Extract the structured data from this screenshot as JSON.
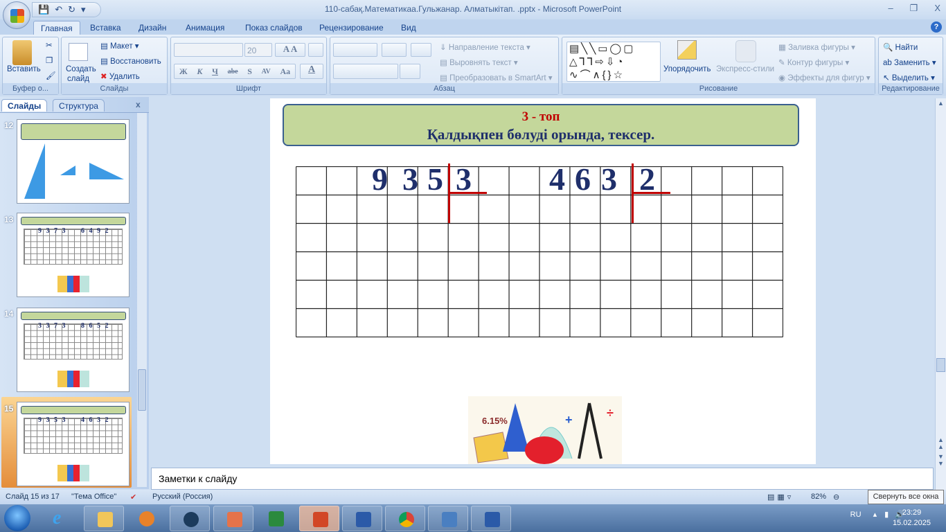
{
  "window": {
    "title": "110-сабақ.Математикаа.Гульжанар. Алматыкітап.     .pptx - Microsoft PowerPoint"
  },
  "ribbon_tabs": [
    "Главная",
    "Вставка",
    "Дизайн",
    "Анимация",
    "Показ слайдов",
    "Рецензирование",
    "Вид"
  ],
  "clipboard": {
    "paste": "Вставить",
    "group": "Буфер о..."
  },
  "slides_group": {
    "new_slide_1": "Создать",
    "new_slide_2": "слайд",
    "layout": "Макет",
    "reset": "Восстановить",
    "delete": "Удалить",
    "group": "Слайды"
  },
  "font": {
    "name": "",
    "size": "20",
    "group": "Шрифт",
    "bold": "Ж",
    "italic": "К",
    "underline": "Ч",
    "strike": "abe",
    "shadow": "S",
    "spacing": "AV",
    "case": "Aa",
    "color": "A"
  },
  "paragraph": {
    "text_direction": "Направление текста",
    "align_text": "Выровнять текст",
    "smartart": "Преобразовать в SmartArt",
    "group": "Абзац"
  },
  "drawing": {
    "arrange": "Упорядочить",
    "quick_styles": "Экспресс-стили",
    "fill": "Заливка фигуры",
    "outline": "Контур фигуры",
    "effects": "Эффекты для фигур",
    "group": "Рисование"
  },
  "editing": {
    "find": "Найти",
    "replace": "Заменить",
    "select": "Выделить",
    "group": "Редактирование"
  },
  "panel": {
    "tab_slides": "Слайды",
    "tab_outline": "Структура",
    "close": "x"
  },
  "thumbnails": [
    {
      "num": "12"
    },
    {
      "num": "13",
      "left": "9 3 7 3",
      "right": "6 4 9 2"
    },
    {
      "num": "14",
      "left": "3 3 7 3",
      "right": "8 6 5 2"
    },
    {
      "num": "15",
      "left": "9 3 5 3",
      "right": "4 6 3 2"
    }
  ],
  "slide": {
    "group_title": "3 - топ",
    "task": "Қалдықпен бөлуді орында, тексер.",
    "left": {
      "digits": [
        "9",
        "3",
        "5"
      ],
      "divisor": "3"
    },
    "right": {
      "digits": [
        "4",
        "6",
        "3"
      ],
      "divisor": "2"
    },
    "clipart_label": "6.15%"
  },
  "notes_placeholder": "Заметки к слайду",
  "status": {
    "slide": "Слайд 15 из 17",
    "theme": "\"Тема Office\"",
    "language": "Русский (Россия)",
    "zoom": "82%"
  },
  "tooltip": "Свернуть все окна",
  "tray": {
    "lang": "RU",
    "time": "23:29",
    "date": "15.02.2025"
  }
}
